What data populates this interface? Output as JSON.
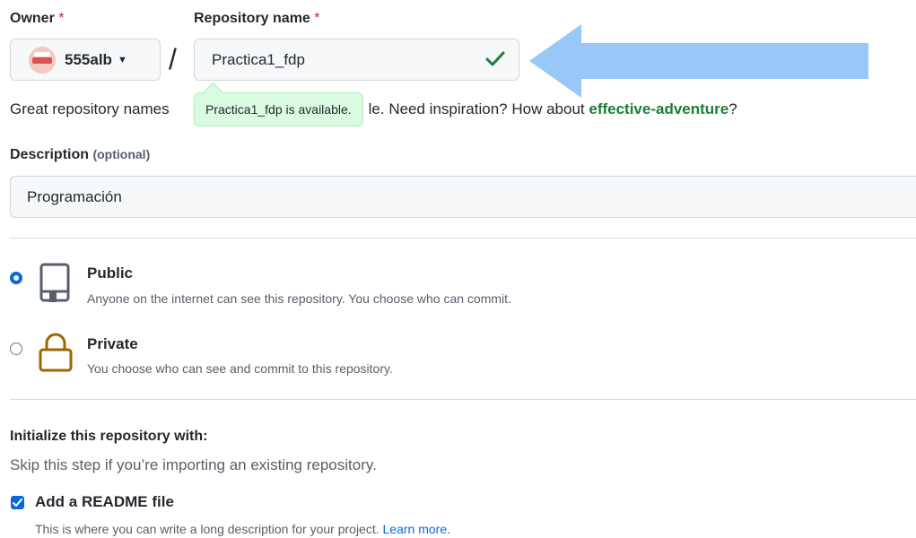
{
  "owner": {
    "label": "Owner",
    "required_mark": "*",
    "name": "555alb"
  },
  "repo": {
    "label": "Repository name",
    "required_mark": "*",
    "value": "Practica1_fdp",
    "availability": "Practica1_fdp is available."
  },
  "hint": {
    "prefix": "Great repository names",
    "visible_suffix": "le. Need inspiration? How about",
    "suggestion": "effective-adventure",
    "end": "?"
  },
  "description": {
    "label": "Description",
    "optional": "(optional)",
    "value": "Programación"
  },
  "visibility": {
    "options": [
      {
        "title": "Public",
        "desc": "Anyone on the internet can see this repository. You choose who can commit.",
        "selected": true
      },
      {
        "title": "Private",
        "desc": "You choose who can see and commit to this repository.",
        "selected": false
      }
    ]
  },
  "init": {
    "heading": "Initialize this repository with:",
    "subtext": "Skip this step if you’re importing an existing repository.",
    "readme_label": "Add a README file",
    "readme_desc": "This is where you can write a long description for your project.",
    "learn_more": "Learn more."
  },
  "colors": {
    "accent": "#0969da",
    "success": "#1a7f37",
    "danger": "#cf222e",
    "private_icon": "#9a6700",
    "arrow": "#99c7f7"
  }
}
